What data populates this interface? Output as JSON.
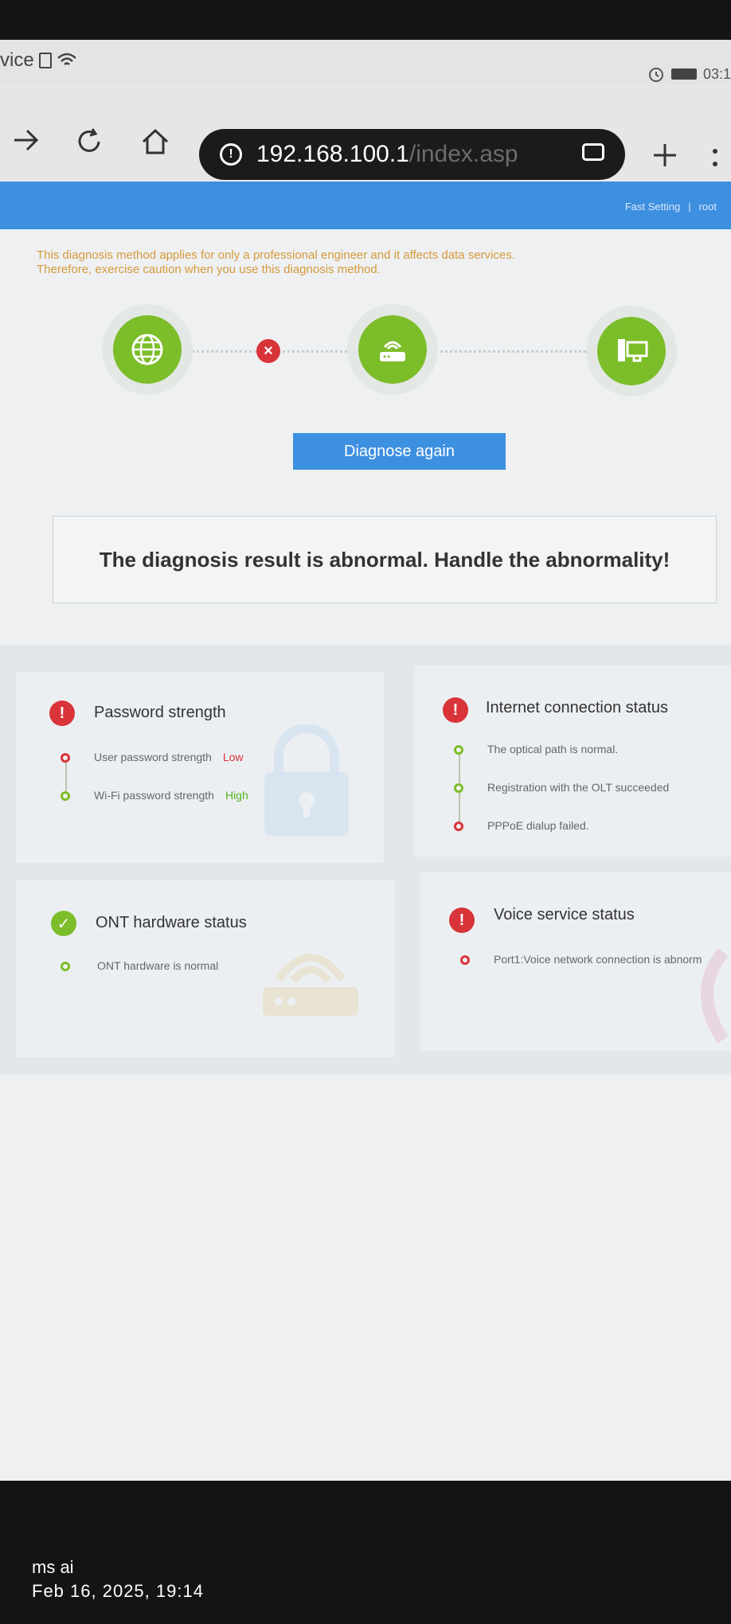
{
  "statusbar": {
    "carrier_fragment": "vice",
    "time_fragment": "03:1"
  },
  "browser": {
    "url_host": "192.168.100.1",
    "url_path": "/index.asp"
  },
  "header": {
    "links": [
      "Fast Setting",
      "|",
      "root"
    ]
  },
  "warning": {
    "line1": "This diagnosis method applies for only a professional engineer and it affects data services.",
    "line2": "Therefore, exercise caution when you use this diagnosis method."
  },
  "diagnose_button": "Diagnose again",
  "result_message": "The diagnosis result is abnormal. Handle the abnormality!",
  "cards": {
    "password": {
      "title": "Password strength",
      "items": [
        {
          "label": "User password strength",
          "value": "Low"
        },
        {
          "label": "Wi-Fi password strength",
          "value": "High"
        }
      ]
    },
    "internet": {
      "title": "Internet connection status",
      "items": [
        {
          "label": "The optical path is normal."
        },
        {
          "label": "Registration with the OLT succeeded"
        },
        {
          "label": "PPPoE dialup failed."
        }
      ]
    },
    "ont": {
      "title": "ONT hardware status",
      "items": [
        {
          "label": "ONT hardware is normal"
        }
      ]
    },
    "voice": {
      "title": "Voice service status",
      "items": [
        {
          "label": "Port1:Voice network connection is abnorm"
        }
      ]
    }
  },
  "caption": {
    "name": "ms ai",
    "date": "Feb 16, 2025, 19:14"
  },
  "colors": {
    "accent": "#3d8fe0",
    "ok": "#7cbd2a",
    "error": "#d8343a",
    "warning_text": "#d69a3b"
  }
}
